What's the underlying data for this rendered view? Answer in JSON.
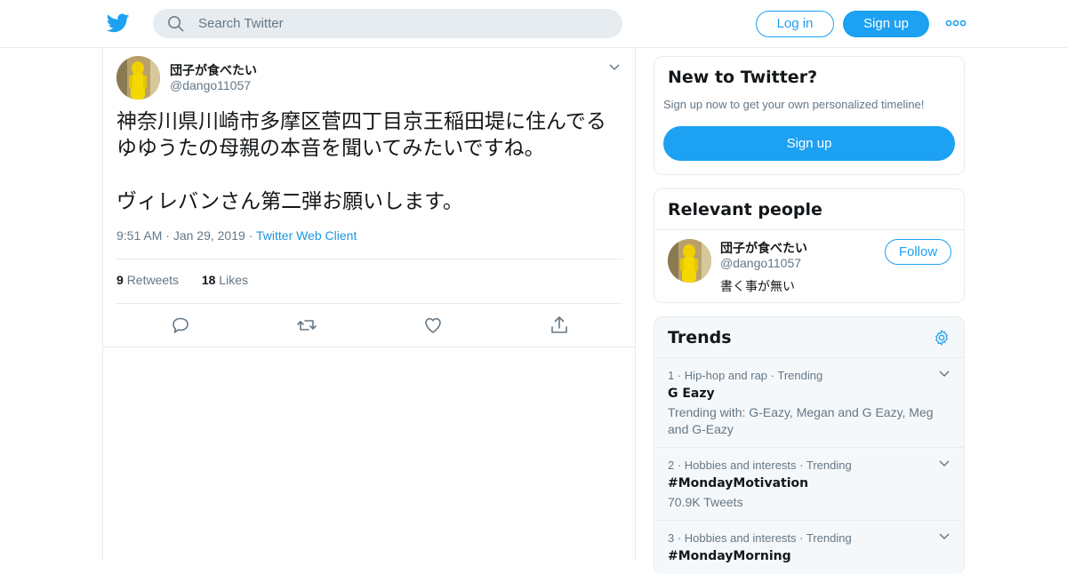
{
  "header": {
    "search_placeholder": "Search Twitter",
    "login_label": "Log in",
    "signup_label": "Sign up"
  },
  "tweet": {
    "author_name": "団子が食べたい",
    "author_handle": "@dango11057",
    "text": "神奈川県川崎市多摩区菅四丁目京王稲田堤に住んでる\nゆゆうたの母親の本音を聞いてみたいですね。\n\nヴィレバンさん第二弾お願いします。",
    "time": "9:51 AM",
    "date": "Jan 29, 2019",
    "source": "Twitter Web Client",
    "retweets_count": "9",
    "retweets_label": "Retweets",
    "likes_count": "18",
    "likes_label": "Likes"
  },
  "sidebar": {
    "new_to_twitter": {
      "title": "New to Twitter?",
      "subtitle": "Sign up now to get your own personalized timeline!",
      "signup_label": "Sign up"
    },
    "relevant_people": {
      "title": "Relevant people",
      "name": "団子が食べたい",
      "handle": "@dango11057",
      "bio": "書く事が無い",
      "follow_label": "Follow"
    },
    "trends": {
      "title": "Trends",
      "items": [
        {
          "rank": "1",
          "category": "Hip-hop and rap",
          "status": "Trending",
          "name": "G Eazy",
          "desc": "Trending with: G-Eazy, Megan and G Eazy, Meg and G-Eazy"
        },
        {
          "rank": "2",
          "category": "Hobbies and interests",
          "status": "Trending",
          "name": "#MondayMotivation",
          "desc": "70.9K Tweets"
        },
        {
          "rank": "3",
          "category": "Hobbies and interests",
          "status": "Trending",
          "name": "#MondayMorning",
          "desc": ""
        }
      ]
    }
  },
  "colors": {
    "brand": "#1da1f2",
    "muted": "#657786",
    "border": "#e6ecf0"
  }
}
